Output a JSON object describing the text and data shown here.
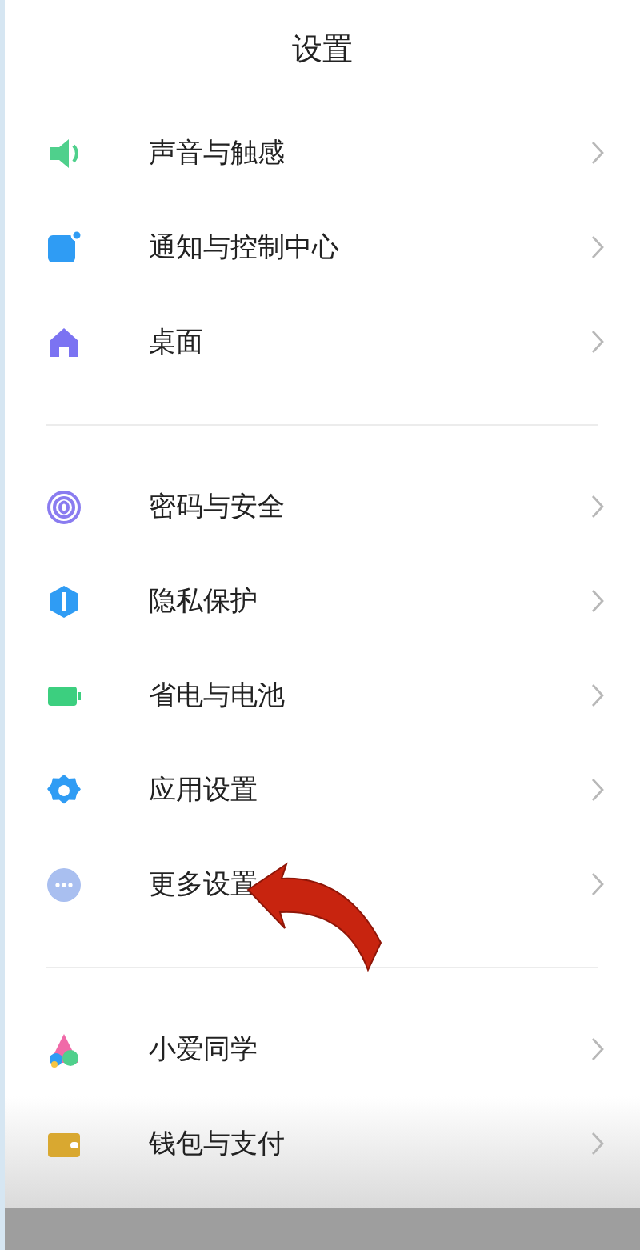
{
  "title": "设置",
  "groups": [
    {
      "items": [
        {
          "label": "声音与触感"
        },
        {
          "label": "通知与控制中心"
        },
        {
          "label": "桌面"
        }
      ]
    },
    {
      "items": [
        {
          "label": "密码与安全"
        },
        {
          "label": "隐私保护"
        },
        {
          "label": "省电与电池"
        },
        {
          "label": "应用设置"
        },
        {
          "label": "更多设置"
        }
      ]
    },
    {
      "items": [
        {
          "label": "小爱同学"
        },
        {
          "label": "钱包与支付"
        }
      ]
    }
  ]
}
